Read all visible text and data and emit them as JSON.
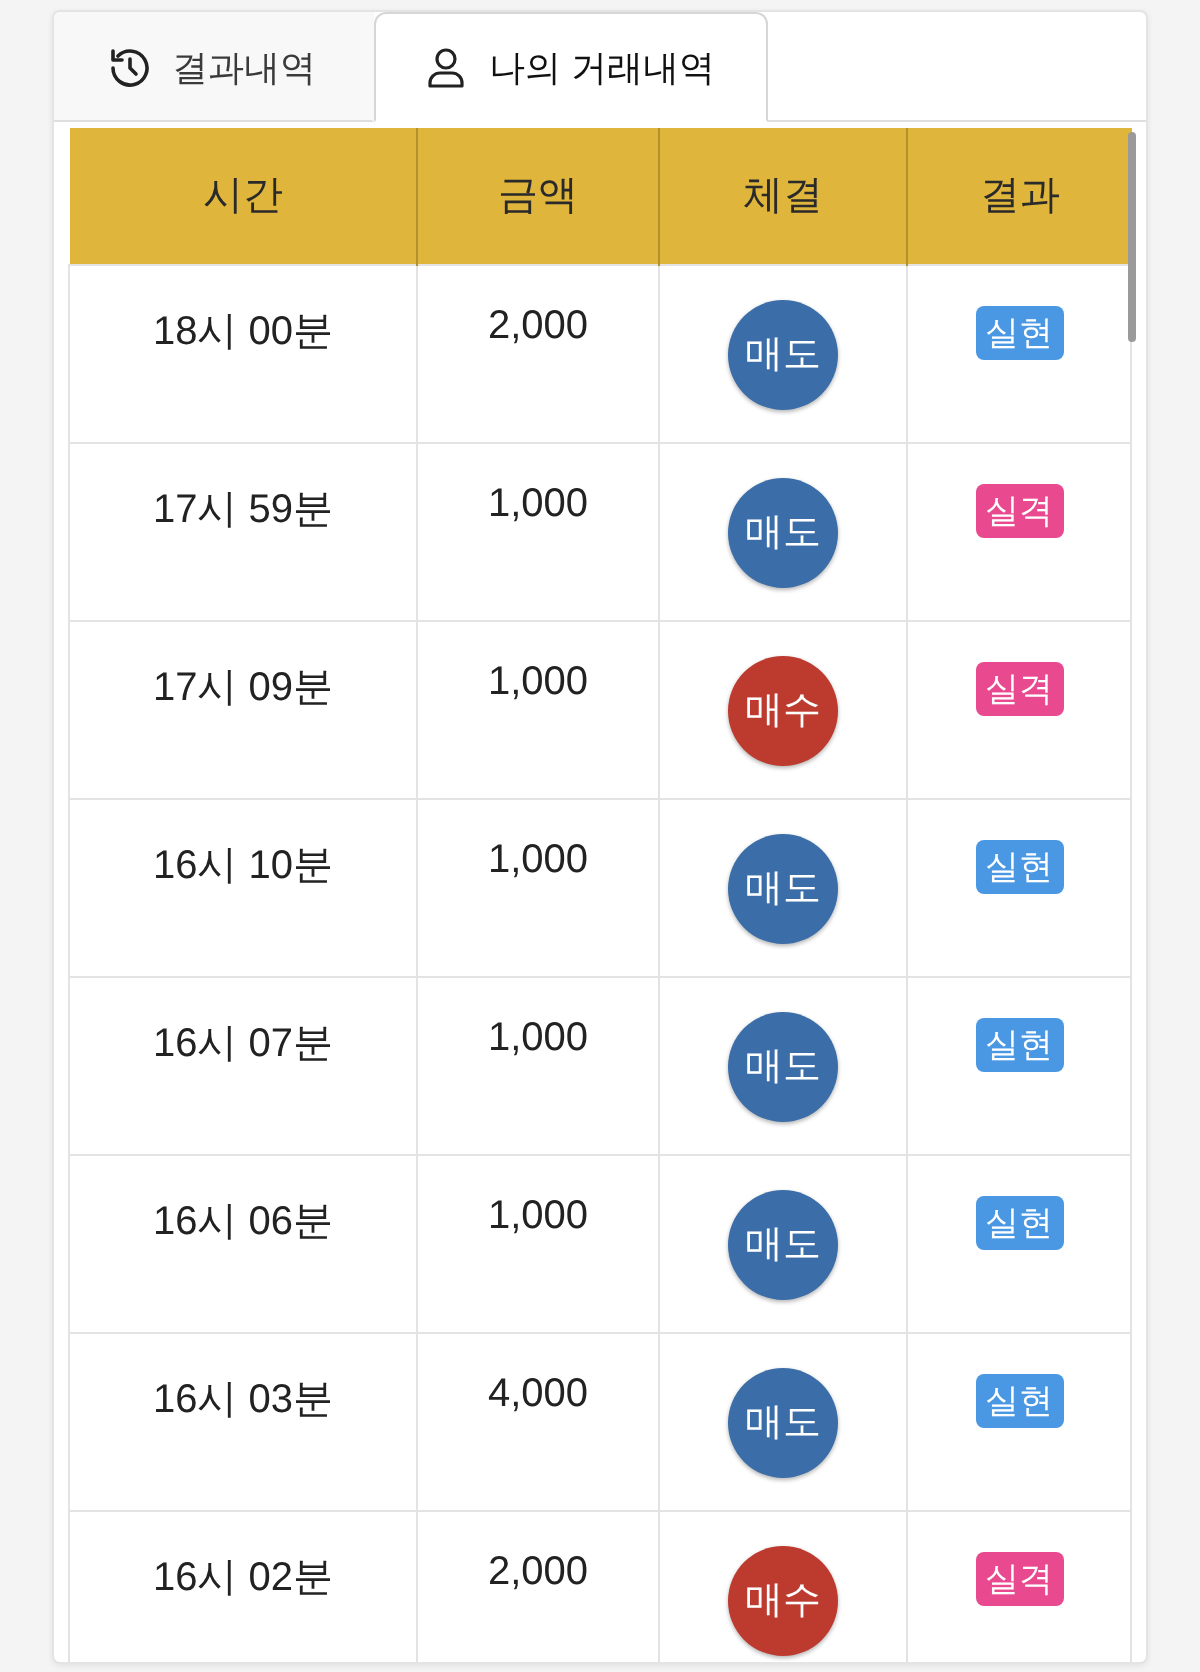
{
  "tabs": [
    {
      "label": "결과내역",
      "selected": false
    },
    {
      "label": "나의 거래내역",
      "selected": true
    }
  ],
  "table": {
    "columns": [
      "시간",
      "금액",
      "체결",
      "결과"
    ],
    "rows": [
      {
        "time": "18시 00분",
        "amount": "2,000",
        "trade": {
          "label": "매도",
          "color": "#3b6ea8"
        },
        "result": {
          "label": "실현",
          "color": "#4a98e3"
        }
      },
      {
        "time": "17시 59분",
        "amount": "1,000",
        "trade": {
          "label": "매도",
          "color": "#3b6ea8"
        },
        "result": {
          "label": "실격",
          "color": "#e8498f"
        }
      },
      {
        "time": "17시 09분",
        "amount": "1,000",
        "trade": {
          "label": "매수",
          "color": "#bd3a2f"
        },
        "result": {
          "label": "실격",
          "color": "#e8498f"
        }
      },
      {
        "time": "16시 10분",
        "amount": "1,000",
        "trade": {
          "label": "매도",
          "color": "#3b6ea8"
        },
        "result": {
          "label": "실현",
          "color": "#4a98e3"
        }
      },
      {
        "time": "16시 07분",
        "amount": "1,000",
        "trade": {
          "label": "매도",
          "color": "#3b6ea8"
        },
        "result": {
          "label": "실현",
          "color": "#4a98e3"
        }
      },
      {
        "time": "16시 06분",
        "amount": "1,000",
        "trade": {
          "label": "매도",
          "color": "#3b6ea8"
        },
        "result": {
          "label": "실현",
          "color": "#4a98e3"
        }
      },
      {
        "time": "16시 03분",
        "amount": "4,000",
        "trade": {
          "label": "매도",
          "color": "#3b6ea8"
        },
        "result": {
          "label": "실현",
          "color": "#4a98e3"
        }
      },
      {
        "time": "16시 02분",
        "amount": "2,000",
        "trade": {
          "label": "매수",
          "color": "#bd3a2f"
        },
        "result": {
          "label": "실격",
          "color": "#e8498f"
        }
      }
    ]
  }
}
